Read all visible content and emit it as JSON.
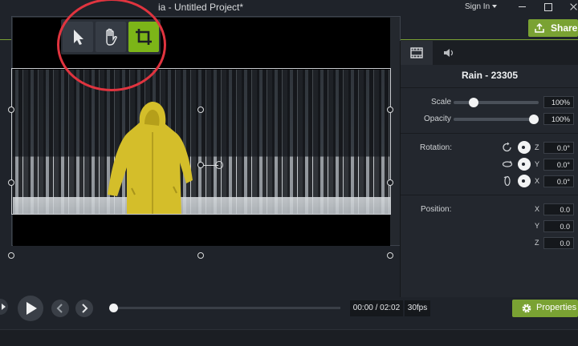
{
  "window": {
    "title": "ia - Untitled Project*",
    "sign_in": "Sign In"
  },
  "toolbar": {
    "zoom_value": "%",
    "share_label": "Share"
  },
  "tools": [
    "arrow-select-tool",
    "hand-pan-tool",
    "crop-tool"
  ],
  "panel": {
    "clip_title": "Rain - 23305",
    "scale_label": "Scale",
    "scale_value": "100%",
    "scale_fraction": 0.2,
    "opacity_label": "Opacity",
    "opacity_value": "100%",
    "opacity_fraction": 1.0,
    "rotation_label": "Rotation:",
    "rotation": [
      {
        "axis": "Z",
        "value": "0.0°"
      },
      {
        "axis": "Y",
        "value": "0.0°"
      },
      {
        "axis": "X",
        "value": "0.0°"
      }
    ],
    "position_label": "Position:",
    "position": [
      {
        "axis": "X",
        "value": "0.0"
      },
      {
        "axis": "Y",
        "value": "0.0"
      },
      {
        "axis": "Z",
        "value": "0.0"
      }
    ]
  },
  "transport": {
    "time": "00:00 / 02:02",
    "fps": "30fps",
    "properties_label": "Properties"
  },
  "colors": {
    "accent": "#7aa233",
    "crop_active": "#7cb518",
    "callout": "#e0343f"
  }
}
